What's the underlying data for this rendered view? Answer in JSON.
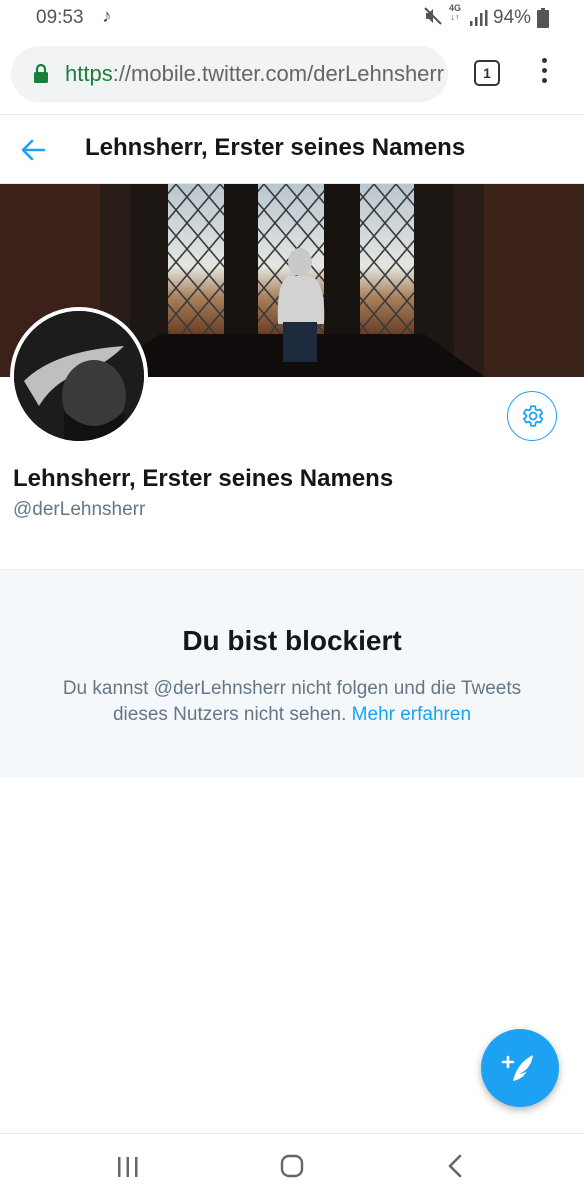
{
  "status_bar": {
    "time": "09:53",
    "network_top": "4G",
    "network_bottom": "↓↑",
    "battery_pct": "94%"
  },
  "browser": {
    "url_scheme": "https",
    "url_rest": "://mobile.twitter.com/derLehnsherr",
    "tab_count": "1"
  },
  "header": {
    "title": "Lehnsherr, Erster seines Namens"
  },
  "profile": {
    "display_name": "Lehnsherr, Erster seines Namens",
    "handle": "@derLehnsherr"
  },
  "blocked": {
    "title": "Du bist blockiert",
    "message": "Du kannst @derLehnsherr nicht folgen und die Tweets dieses Nutzers nicht sehen. ",
    "link": "Mehr erfahren"
  },
  "colors": {
    "accent": "#1da1f2",
    "secure_green": "#188038",
    "muted_text": "#657786"
  },
  "icons": [
    "music-note-icon",
    "mute-icon",
    "signal-icon",
    "battery-icon",
    "lock-icon",
    "tabs-icon",
    "overflow-menu-icon",
    "back-arrow-icon",
    "gear-icon",
    "compose-tweet-icon",
    "recent-apps-icon",
    "home-icon",
    "nav-back-icon"
  ]
}
